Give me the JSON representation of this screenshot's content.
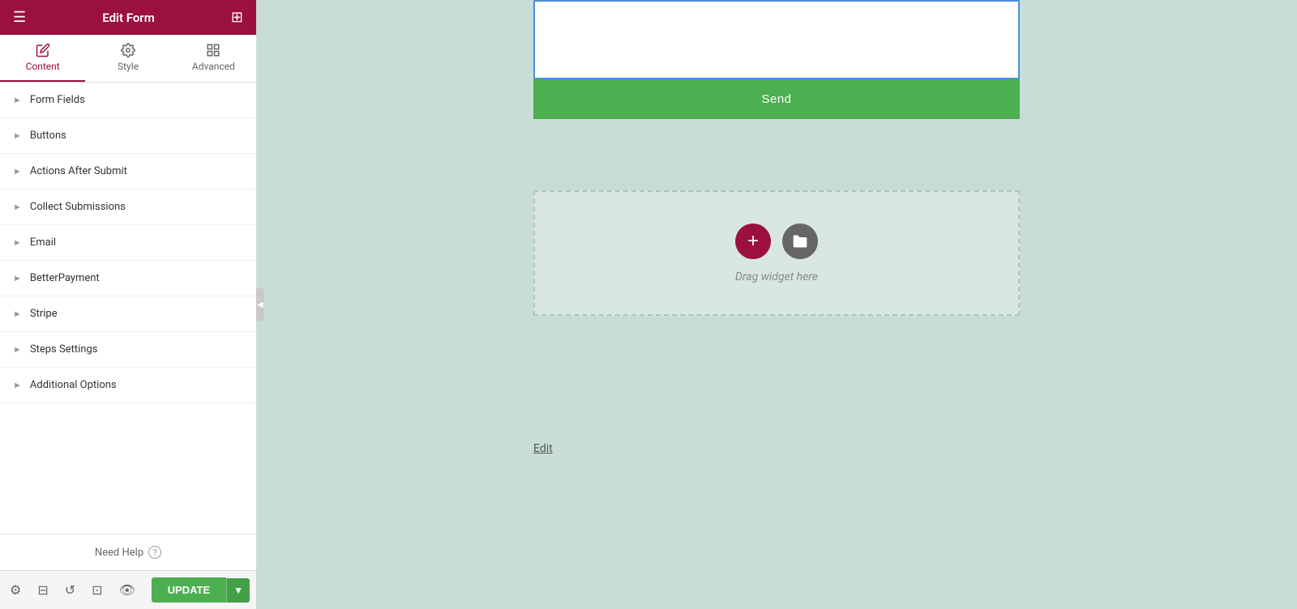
{
  "header": {
    "title": "Edit Form",
    "menu_icon": "☰",
    "grid_icon": "⊞"
  },
  "tabs": [
    {
      "id": "content",
      "label": "Content",
      "active": true
    },
    {
      "id": "style",
      "label": "Style",
      "active": false
    },
    {
      "id": "advanced",
      "label": "Advanced",
      "active": false
    }
  ],
  "accordion": {
    "items": [
      {
        "id": "form-fields",
        "label": "Form Fields"
      },
      {
        "id": "buttons",
        "label": "Buttons"
      },
      {
        "id": "actions-after-submit",
        "label": "Actions After Submit"
      },
      {
        "id": "collect-submissions",
        "label": "Collect Submissions"
      },
      {
        "id": "email",
        "label": "Email"
      },
      {
        "id": "better-payment",
        "label": "BetterPayment"
      },
      {
        "id": "stripe",
        "label": "Stripe"
      },
      {
        "id": "steps-settings",
        "label": "Steps Settings"
      },
      {
        "id": "additional-options",
        "label": "Additional Options"
      }
    ]
  },
  "footer": {
    "need_help_label": "Need Help",
    "help_icon": "?"
  },
  "bottom_bar": {
    "update_label": "UPDATE",
    "arrow": "▼",
    "icons": [
      "⚙",
      "⊟",
      "↺",
      "⊡",
      "👁"
    ]
  },
  "canvas": {
    "send_button_label": "Send",
    "drop_zone_text": "Drag widget here",
    "edit_link": "Edit",
    "add_btn_label": "+",
    "folder_btn_label": "📁"
  },
  "colors": {
    "brand_dark": "#9b1040",
    "green": "#4caf50",
    "canvas_bg": "#c8ddd8"
  }
}
